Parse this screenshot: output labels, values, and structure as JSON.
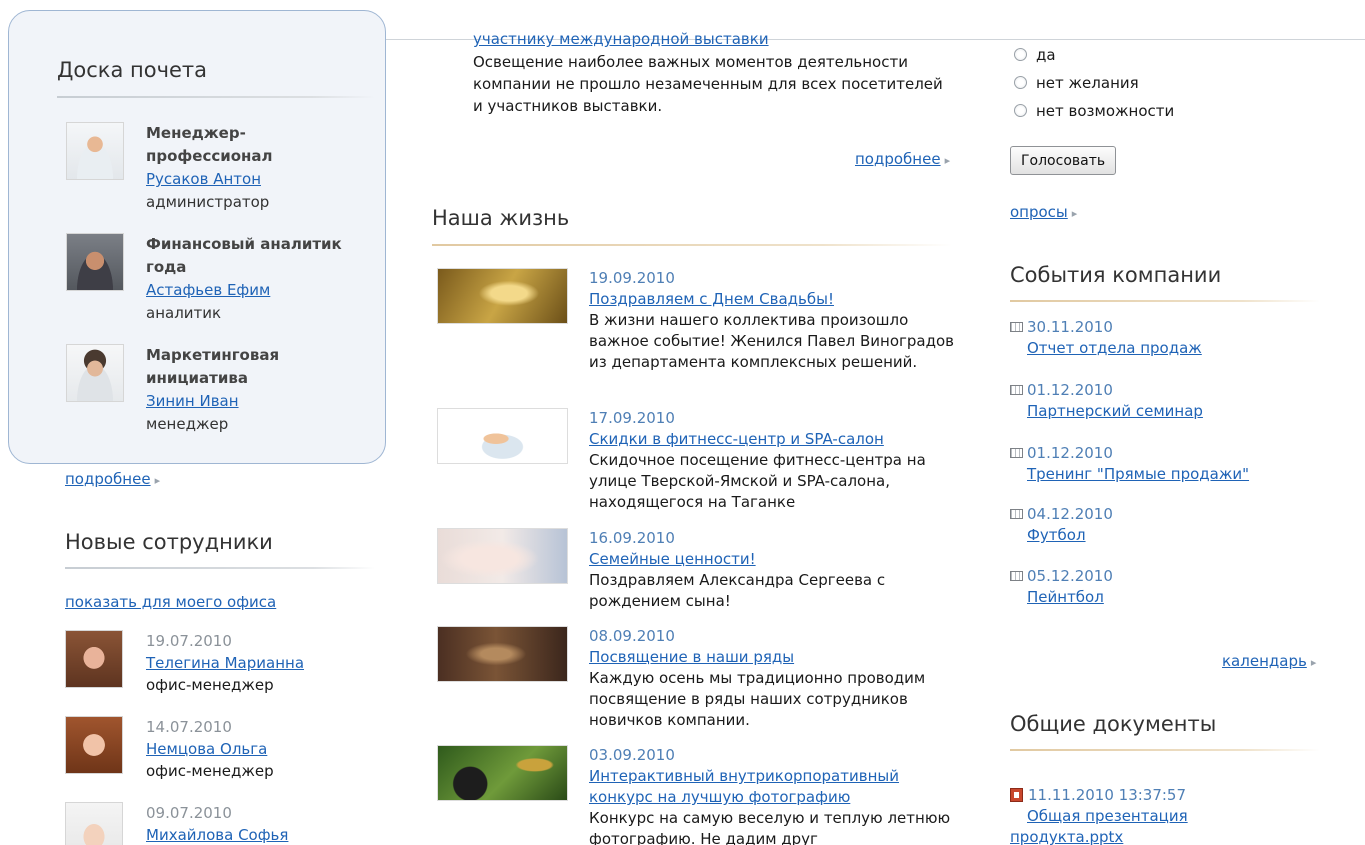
{
  "honor_board": {
    "title": "Доска почета",
    "items": [
      {
        "award": "Менеджер-профессионал",
        "name": "Русаков Антон",
        "role": "администратор"
      },
      {
        "award": "Финансовый аналитик года",
        "name": "Астафьев Ефим",
        "role": "аналитик"
      },
      {
        "award": "Маркетинговая инициатива",
        "name": "Зинин Иван",
        "role": "менеджер"
      }
    ],
    "more_label": "подробнее"
  },
  "new_staff": {
    "title": "Новые сотрудники",
    "show_office_label": "показать для моего офиса",
    "items": [
      {
        "date": "19.07.2010",
        "name": "Телегина Марианна",
        "role": "офис-менеджер"
      },
      {
        "date": "14.07.2010",
        "name": "Немцова Ольга",
        "role": "офис-менеджер"
      },
      {
        "date": "09.07.2010",
        "name": "Михайлова Софья"
      }
    ]
  },
  "top_news": {
    "link": "участнику международной выставки",
    "text": "Освещение наиболее важных моментов деятельности компании не прошло незамеченным для всех посетителей и участников выставки.",
    "more_label": "подробнее"
  },
  "our_life": {
    "title": "Наша жизнь",
    "items": [
      {
        "date": "19.09.2010",
        "title": "Поздравляем с Днем Свадьбы!",
        "text": "В жизни нашего коллектива произошло важное событие! Женился Павел Виноградов из департамента комплексных решений."
      },
      {
        "date": "17.09.2010",
        "title": "Скидки в фитнесс-центр и SPA-салон",
        "text": "Скидочное посещение фитнесс-центра на улице Тверской-Ямской и SPA-салона, находящегося на Таганке"
      },
      {
        "date": "16.09.2010",
        "title": "Семейные ценности!",
        "text": "Поздравляем Александра Сергеева с рождением сына!"
      },
      {
        "date": "08.09.2010",
        "title": "Посвящение в наши ряды",
        "text": "Каждую осень мы традиционно проводим  посвящение в ряды наших сотрудников новичков компании."
      },
      {
        "date": "03.09.2010",
        "title": "Интерактивный внутрикорпоративный конкурс на лучшую фотографию",
        "text": "Конкурс на самую веселую и теплую летнюю фотографию. Не дадим друг"
      }
    ]
  },
  "poll": {
    "options": [
      "да",
      "нет желания",
      "нет возможности"
    ],
    "vote_label": "Голосовать",
    "polls_link": "опросы"
  },
  "events": {
    "title": "События компании",
    "items": [
      {
        "date": "30.11.2010",
        "title": "Отчет отдела продаж"
      },
      {
        "date": "01.12.2010",
        "title": "Партнерский семинар"
      },
      {
        "date": "01.12.2010",
        "title": "Тренинг \"Прямые продажи\""
      },
      {
        "date": "04.12.2010",
        "title": "Футбол"
      },
      {
        "date": "05.12.2010",
        "title": "Пейнтбол"
      }
    ],
    "calendar_link": "календарь"
  },
  "documents": {
    "title": "Общие документы",
    "items": [
      {
        "datetime": "11.11.2010 13:37:57",
        "title": "Общая презентация",
        "file": "продукта.pptx"
      }
    ]
  }
}
